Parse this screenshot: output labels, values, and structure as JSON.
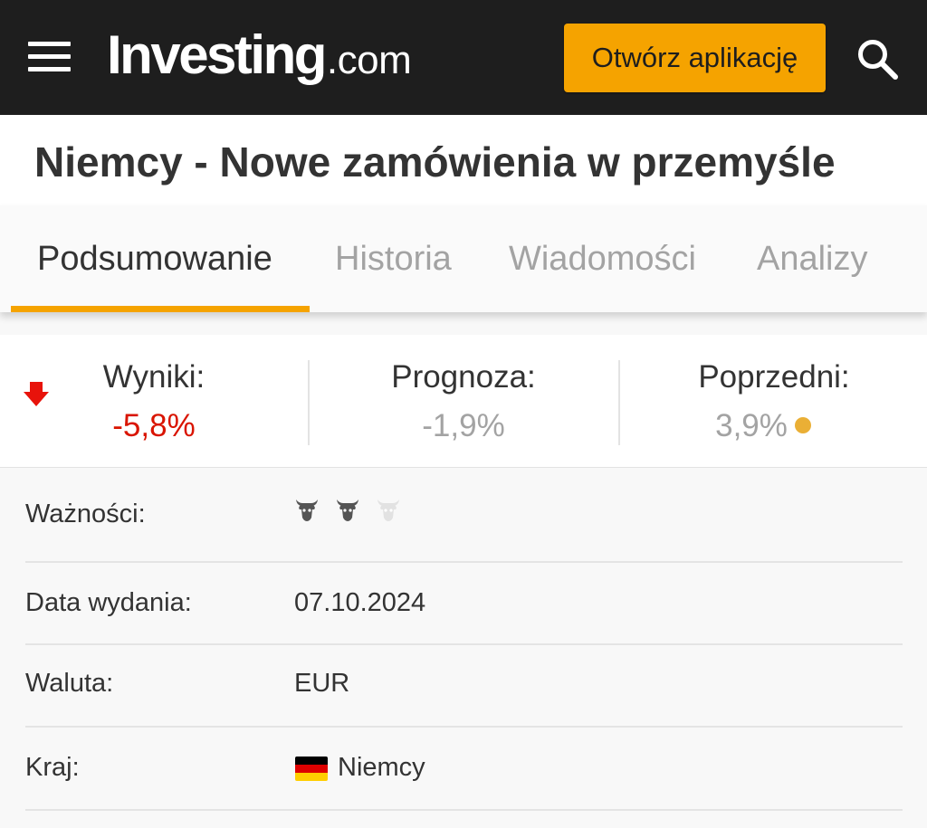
{
  "header": {
    "logo_main": "Investing",
    "logo_suffix": ".com",
    "open_app_label": "Otwórz aplikację",
    "icons": [
      "hamburger-menu-icon",
      "search-icon"
    ],
    "background_color": "#1e1e1e",
    "accent_color": "#f5a300"
  },
  "page": {
    "title": "Niemcy - Nowe zamówienia w przemyśle"
  },
  "tabs": [
    {
      "label": "Podsumowanie",
      "active": true
    },
    {
      "label": "Historia",
      "active": false
    },
    {
      "label": "Wiadomości",
      "active": false
    },
    {
      "label": "Analizy",
      "active": false
    }
  ],
  "stats": {
    "actual": {
      "label": "Wyniki:",
      "value": "-5,8%",
      "trend_icon": "arrow-down-icon",
      "color": "#d91400"
    },
    "forecast": {
      "label": "Prognoza:",
      "value": "-1,9%"
    },
    "previous": {
      "label": "Poprzedni:",
      "value": "3,9%",
      "indicator_color": "#eaaf35"
    }
  },
  "details": {
    "importance": {
      "label": "Ważności:",
      "level": 2,
      "max": 3,
      "icon": "bull-icon"
    },
    "release_date": {
      "label": "Data wydania:",
      "value": "07.10.2024"
    },
    "currency": {
      "label": "Waluta:",
      "value": "EUR"
    },
    "country": {
      "label": "Kraj:",
      "value": "Niemcy",
      "flag": "germany-flag-icon",
      "flag_colors": [
        "#000000",
        "#dd0000",
        "#ffce00"
      ]
    }
  }
}
